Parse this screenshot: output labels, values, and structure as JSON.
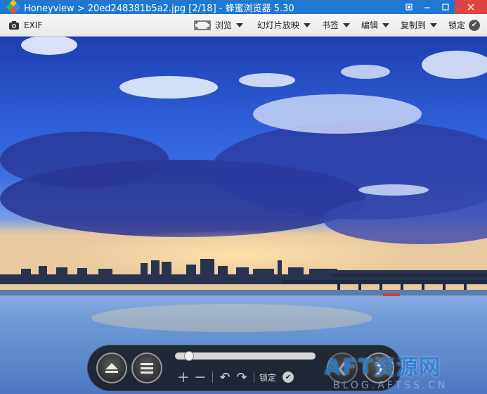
{
  "titlebar": {
    "title": "Honeyview > 20ed248381b5a2.jpg [2/18] - 蜂蜜浏览器 5.30",
    "controls": [
      "restore-down-icon",
      "minimize-icon",
      "maximize-icon",
      "close-icon"
    ]
  },
  "toolbar": {
    "exif_label": "EXIF",
    "browse_label": "浏览",
    "slideshow_label": "幻灯片放映",
    "bookmark_label": "书签",
    "edit_label": "编辑",
    "copy_to_label": "复制到",
    "lock_label": "锁定"
  },
  "controls": {
    "seek_position": 0.07,
    "lock_label": "锁定",
    "icons": [
      "eject-icon",
      "menu-icon",
      "zoom-in-icon",
      "zoom-out-icon",
      "rotate-left-icon",
      "rotate-right-icon",
      "checkmark-icon",
      "previous-icon",
      "next-icon"
    ]
  },
  "watermark": {
    "main": "AFT资源网",
    "sub": "BLOG.AFTSS.CN"
  },
  "colors": {
    "titlebar": "#1f78d1",
    "close_button": "#e04343",
    "toolbar": "#efefef",
    "sky_top": "#1a3fae",
    "water": "#6d9ad6",
    "watermark_blue": "#2a7fd4"
  }
}
